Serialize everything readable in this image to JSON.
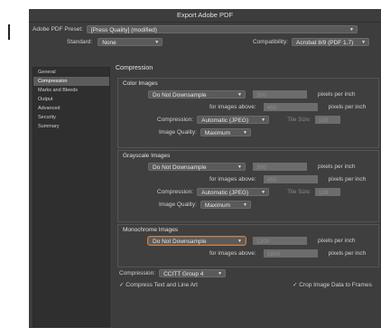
{
  "window": {
    "title": "Export Adobe PDF"
  },
  "top": {
    "preset_label": "Adobe PDF Preset:",
    "preset_value": "[Press Quality] (modified)",
    "standard_label": "Standard:",
    "standard_value": "None",
    "compat_label": "Compatibility:",
    "compat_value": "Acrobat 8/9 (PDF 1.7)"
  },
  "sidebar": {
    "items": [
      {
        "label": "General"
      },
      {
        "label": "Compression"
      },
      {
        "label": "Marks and Bleeds"
      },
      {
        "label": "Output"
      },
      {
        "label": "Advanced"
      },
      {
        "label": "Security"
      },
      {
        "label": "Summary"
      }
    ]
  },
  "main": {
    "title": "Compression",
    "color": {
      "title": "Color Images",
      "downsample": "Do Not Downsample",
      "ppi": "300",
      "ppi_unit": "pixels per inch",
      "above_label": "for images above:",
      "above": "450",
      "above_unit": "pixels per inch",
      "compression_label": "Compression:",
      "compression": "Automatic (JPEG)",
      "tile_label": "Tile Size:",
      "tile": "128",
      "quality_label": "Image Quality:",
      "quality": "Maximum"
    },
    "gray": {
      "title": "Grayscale Images",
      "downsample": "Do Not Downsample",
      "ppi": "300",
      "ppi_unit": "pixels per inch",
      "above_label": "for images above:",
      "above": "450",
      "above_unit": "pixels per inch",
      "compression_label": "Compression:",
      "compression": "Automatic (JPEG)",
      "tile_label": "Tile Size:",
      "tile": "128",
      "quality_label": "Image Quality:",
      "quality": "Maximum"
    },
    "mono": {
      "title": "Monochrome Images",
      "downsample": "Do Not Downsample",
      "ppi": "1200",
      "ppi_unit": "pixels per inch",
      "above_label": "for images above:",
      "above": "1800",
      "above_unit": "pixels per inch",
      "compression_label": "Compression:",
      "compression": "CCITT Group 4"
    },
    "compress_text": "Compress Text and Line Art",
    "crop_image": "Crop Image Data to Frames"
  }
}
